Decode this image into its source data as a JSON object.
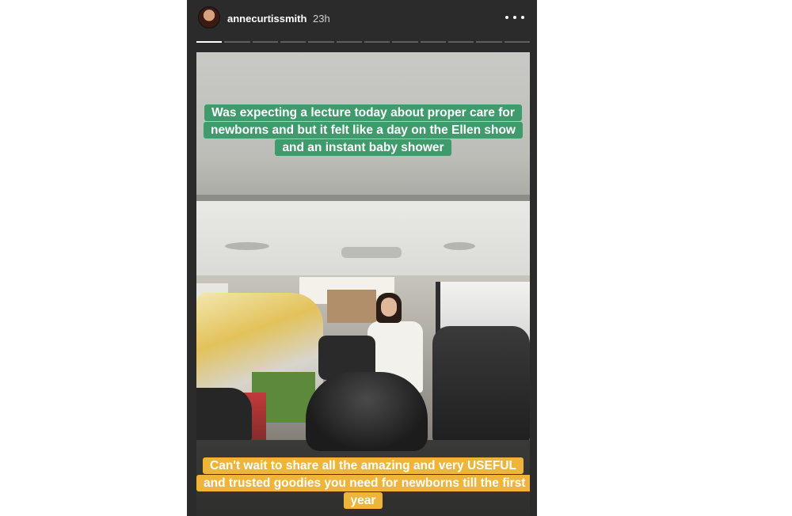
{
  "story": {
    "header": {
      "username": "annecurtissmith",
      "time": "23h",
      "more_icon": "more-dots-icon",
      "avatar_icon": "avatar"
    },
    "progress": {
      "segments": 12,
      "active_index": 0
    },
    "captions": {
      "top": "Was expecting a lecture today about proper care for newborns and  but it felt like a day on the Ellen show and an instant baby shower",
      "bottom": "Can't wait to share all the amazing and very USEFUL and trusted goodies you need for newborns till the first year"
    },
    "colors": {
      "top_caption_bg": "#3f9b6c",
      "bottom_caption_bg": "#efb43a",
      "story_bg": "#2b2b2b"
    }
  }
}
